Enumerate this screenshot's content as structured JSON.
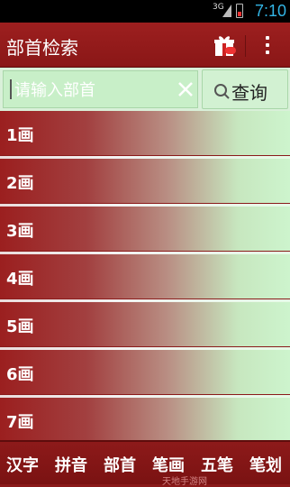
{
  "status_bar": {
    "network": "3G",
    "time": "7:10"
  },
  "action_bar": {
    "title": "部首检索",
    "gift_icon": "gift-icon",
    "more_icon": "overflow-menu-icon"
  },
  "search": {
    "placeholder": "请输入部首",
    "value": "",
    "clear_icon": "clear-x-icon",
    "button_icon": "search-icon",
    "button_label": "查询"
  },
  "strokes": {
    "items": [
      "1画",
      "2画",
      "3画",
      "4画",
      "5画",
      "6画",
      "7画"
    ]
  },
  "tabs": {
    "items": [
      "汉字",
      "拼音",
      "部首",
      "笔画",
      "五笔",
      "笔划"
    ],
    "active": "部首"
  },
  "watermark": "天地手游网",
  "colors": {
    "primary_red": "#9d1f1f",
    "light_green": "#cdf4cd",
    "status_time": "#33b5e5"
  }
}
